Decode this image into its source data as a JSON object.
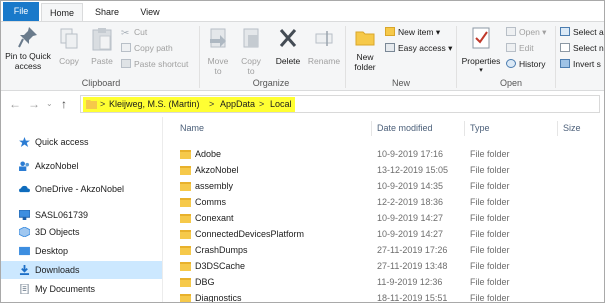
{
  "tabs": {
    "file": "File",
    "home": "Home",
    "share": "Share",
    "view": "View"
  },
  "ribbon": {
    "clipboard": {
      "pin_line1": "Pin to Quick",
      "pin_line2": "access",
      "copy": "Copy",
      "paste": "Paste",
      "cut": "Cut",
      "copy_path": "Copy path",
      "paste_shortcut": "Paste shortcut",
      "label": "Clipboard"
    },
    "organize": {
      "move_to_line1": "Move",
      "move_to_line2": "to",
      "copy_to_line1": "Copy",
      "copy_to_line2": "to",
      "delete": "Delete",
      "rename": "Rename",
      "label": "Organize"
    },
    "new": {
      "new_folder_line1": "New",
      "new_folder_line2": "folder",
      "new_item": "New item",
      "easy_access": "Easy access",
      "label": "New"
    },
    "open": {
      "properties": "Properties",
      "open": "Open",
      "edit": "Edit",
      "history": "History",
      "label": "Open"
    },
    "select": {
      "select_all": "Select a",
      "select_none": "Select n",
      "invert": "Invert s"
    }
  },
  "address": {
    "path": [
      "Kleijweg, M.S. (Martin)",
      "AppData",
      "Local"
    ],
    "separator": ">"
  },
  "nav": {
    "items": [
      {
        "label": "Quick access",
        "icon": "star-icon"
      },
      {
        "label": "AkzoNobel",
        "icon": "people-icon"
      },
      {
        "label": "OneDrive - AkzoNobel",
        "icon": "cloud-icon"
      },
      {
        "label": "SASL061739",
        "icon": "computer-icon"
      },
      {
        "label": "3D Objects",
        "icon": "cube-icon"
      },
      {
        "label": "Desktop",
        "icon": "desktop-icon"
      },
      {
        "label": "Downloads",
        "icon": "download-icon"
      },
      {
        "label": "My Documents",
        "icon": "document-icon"
      }
    ]
  },
  "list": {
    "columns": {
      "name": "Name",
      "date": "Date modified",
      "type": "Type",
      "size": "Size"
    },
    "rows": [
      {
        "name": "Adobe",
        "date": "10-9-2019 17:16",
        "type": "File folder"
      },
      {
        "name": "AkzoNobel",
        "date": "13-12-2019 15:05",
        "type": "File folder"
      },
      {
        "name": "assembly",
        "date": "10-9-2019 14:35",
        "type": "File folder"
      },
      {
        "name": "Comms",
        "date": "12-2-2019 18:36",
        "type": "File folder"
      },
      {
        "name": "Conexant",
        "date": "10-9-2019 14:27",
        "type": "File folder"
      },
      {
        "name": "ConnectedDevicesPlatform",
        "date": "10-9-2019 14:27",
        "type": "File folder"
      },
      {
        "name": "CrashDumps",
        "date": "27-11-2019 17:26",
        "type": "File folder"
      },
      {
        "name": "D3DSCache",
        "date": "27-11-2019 13:48",
        "type": "File folder"
      },
      {
        "name": "DBG",
        "date": "11-9-2019 12:36",
        "type": "File folder"
      },
      {
        "name": "Diagnostics",
        "date": "18-11-2019 15:51",
        "type": "File folder"
      }
    ]
  },
  "colors": {
    "file_tab": "#1979ca",
    "highlight": "#ffff33",
    "selected": "#cce8ff",
    "folder": "#f6c94a"
  }
}
